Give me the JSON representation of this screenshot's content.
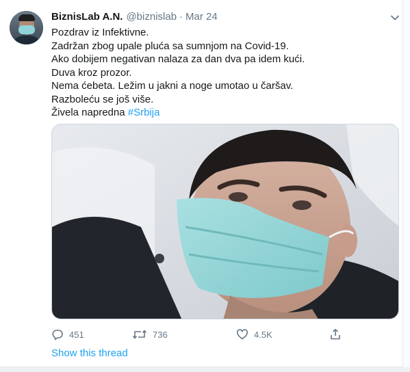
{
  "tweet": {
    "display_name": "BiznisLab A.N.",
    "handle": "@biznislab",
    "separator": "·",
    "date": "Mar 24",
    "lines": [
      "Pozdrav iz Infektivne.",
      "Zadržan zbog upale pluća sa sumnjom na Covid-19.",
      "Ako dobijem negativan nalaza za dan dva pa idem kući.",
      "Duva kroz prozor.",
      "Nema ćebeta. Ležim u jakni a noge umotao u čaršav.",
      "Razboleću se još više."
    ],
    "last_line_text": "Živela napredna ",
    "hashtag": "#Srbija"
  },
  "actions": {
    "replies": "451",
    "retweets": "736",
    "likes": "4.5K"
  },
  "show_thread": "Show this thread",
  "icons": {
    "caret": "chevron-down-icon",
    "reply": "reply-icon",
    "retweet": "retweet-icon",
    "like": "heart-icon",
    "share": "share-icon"
  },
  "colors": {
    "link": "#1da1f2",
    "secondary_text": "#657786",
    "primary_text": "#14171a"
  }
}
